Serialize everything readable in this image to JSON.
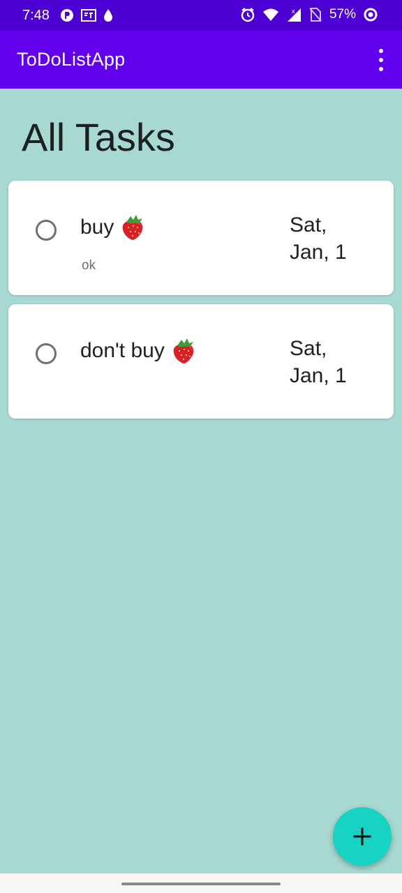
{
  "status_bar": {
    "time": "7:48",
    "battery_text": "57%",
    "left_icons": [
      "app-icon",
      "currency-icon",
      "droplet-icon"
    ],
    "right_icons": [
      "alarm-icon",
      "wifi-icon",
      "signal-icon",
      "no-sim-icon",
      "battery-ring-icon"
    ]
  },
  "app_bar": {
    "title": "ToDoListApp",
    "menu_icon": "more-vert-icon"
  },
  "page": {
    "heading": "All Tasks"
  },
  "tasks": [
    {
      "title": "buy",
      "emoji": "🍓",
      "note": "ok",
      "date_line1": "Sat,",
      "date_line2": "Jan, 1",
      "completed": false
    },
    {
      "title": "don't buy",
      "emoji": "🍓",
      "note": "",
      "date_line1": "Sat,",
      "date_line2": "Jan, 1",
      "completed": false
    }
  ],
  "fab": {
    "icon": "plus-icon"
  },
  "colors": {
    "status_bar": "#4c00d4",
    "app_bar": "#6200ee",
    "background": "#a7d8d1",
    "fab": "#17d3c3"
  }
}
